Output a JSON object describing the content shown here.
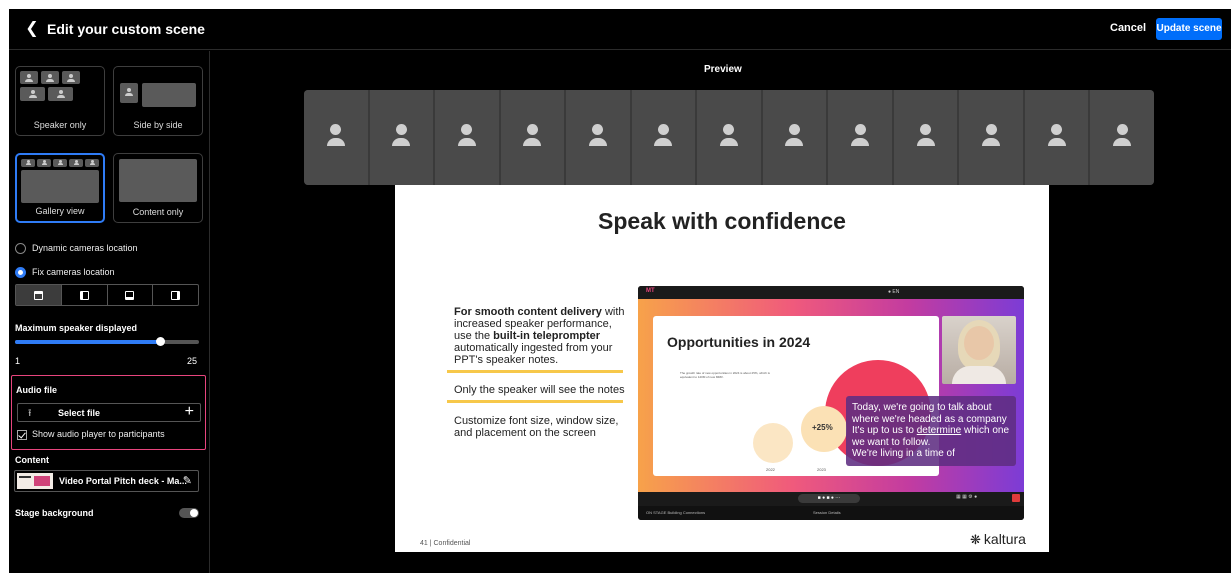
{
  "header": {
    "title": "Edit your custom scene",
    "cancel_label": "Cancel",
    "update_label": "Update scene"
  },
  "layouts": [
    {
      "label": "Speaker only",
      "selected": false
    },
    {
      "label": "Side by side",
      "selected": false
    },
    {
      "label": "Gallery view",
      "selected": true
    },
    {
      "label": "Content only",
      "selected": false
    }
  ],
  "camera_location": {
    "options": [
      {
        "label": "Dynamic cameras location",
        "selected": false
      },
      {
        "label": "Fix cameras location",
        "selected": true
      }
    ],
    "positions": [
      "top",
      "left",
      "bottom",
      "right"
    ],
    "active_position": "top"
  },
  "max_speaker": {
    "label": "Maximum speaker displayed",
    "min": "1",
    "max": "25",
    "value_fraction": 0.79
  },
  "audio": {
    "label": "Audio file",
    "select_label": "Select file",
    "show_player_label": "Show audio player to participants",
    "show_player_checked": true
  },
  "content": {
    "label": "Content",
    "item_name": "Video Portal Pitch deck - Ma..."
  },
  "stage_background": {
    "label": "Stage background",
    "enabled": false
  },
  "preview": {
    "title": "Preview",
    "camera_count": 13,
    "slide": {
      "title": "Speak with confidence",
      "point1_bold1": "For smooth content delivery",
      "point1_rest1": " with",
      "point1_line2": "increased speaker performance,",
      "point1_pre3": "use the ",
      "point1_bold3": "built-in teleprompter",
      "point1_line4": "automatically ingested from your",
      "point1_line5": "PPT's speaker notes.",
      "point2": "Only the speaker will see the notes",
      "point3_line1": "Customize font size, window size,",
      "point3_line2": "and placement on the screen",
      "footer": "41 | Confidential",
      "logo": "kaltura",
      "mock": {
        "brand": "MT",
        "user_menu": "EN",
        "card_title": "Opportunities in 2024",
        "note": "The growth rate of new opportunities in 2024 is about 25%, which is equivalent to 120M of new MRR.",
        "pct": "+25%",
        "year1": "2022",
        "year2": "2023",
        "teleprompter_line1": "Today, we're going to talk about",
        "teleprompter_line2": "where we're headed as a company",
        "teleprompter_line3_pre": "It's up to us to ",
        "teleprompter_line3_u": "determine",
        "teleprompter_line3_post": " which one",
        "teleprompter_line4": "we want to follow.",
        "teleprompter_line5": "We're living in a time of",
        "bottom_left": "ON STAGE  Building Connections",
        "bottom_right": "Session Details"
      }
    }
  },
  "colors": {
    "accent": "#006efa",
    "highlight_border": "#e8457e",
    "slide_underline": "#f7c84a"
  }
}
